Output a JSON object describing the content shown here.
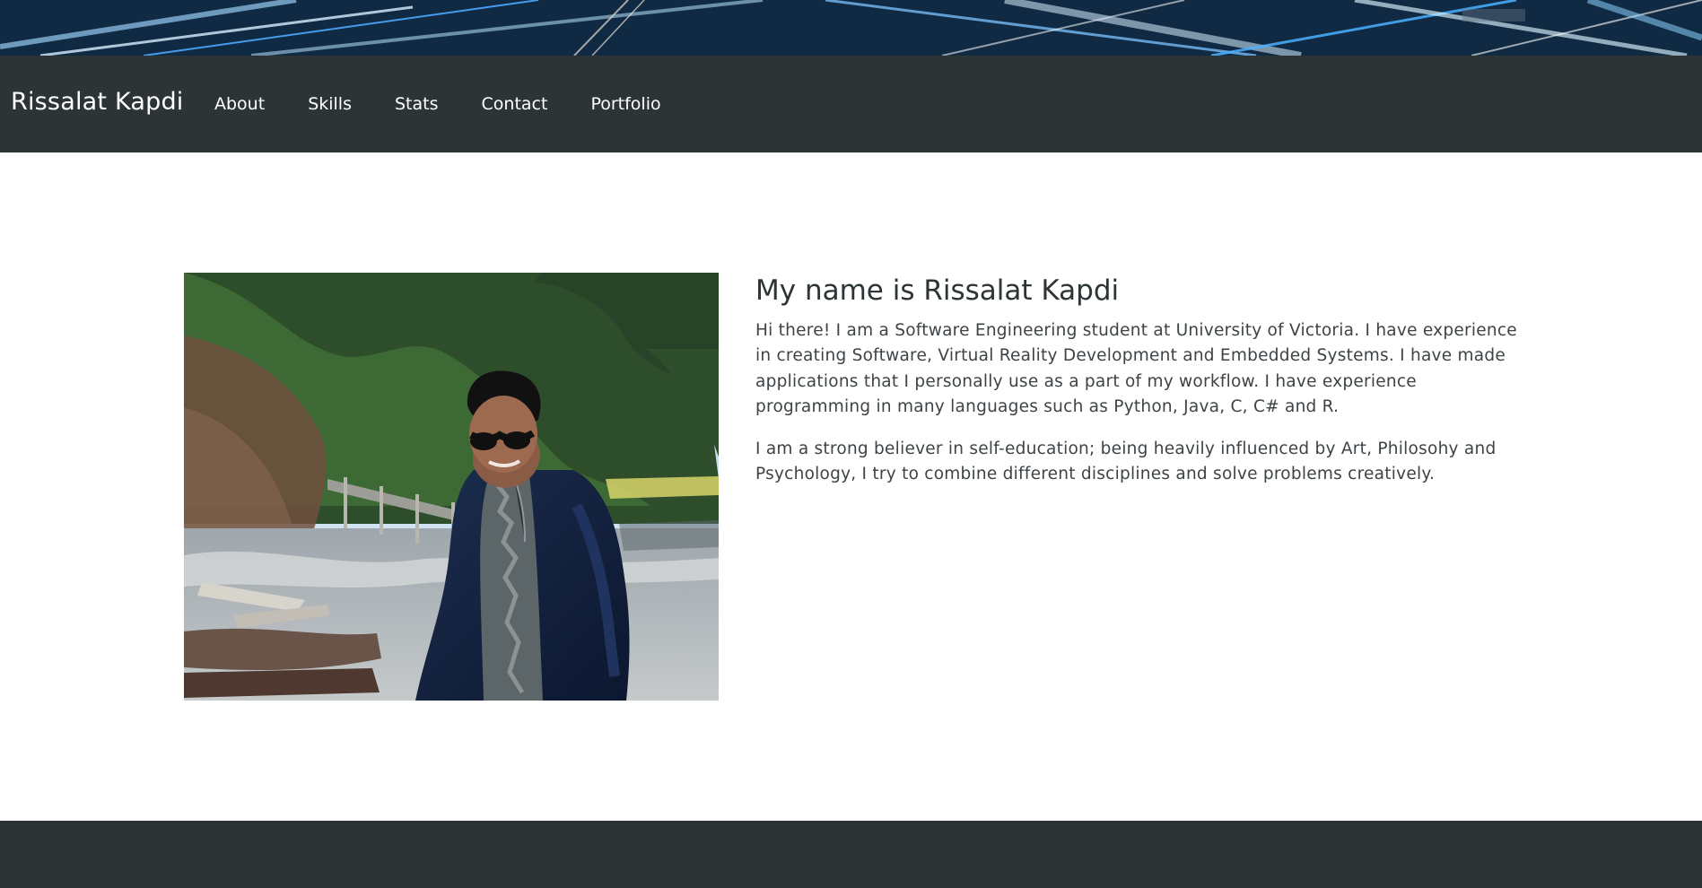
{
  "navbar": {
    "brand": "Rissalat Kapdi",
    "links": [
      {
        "label": "About"
      },
      {
        "label": "Skills"
      },
      {
        "label": "Stats"
      },
      {
        "label": "Contact"
      },
      {
        "label": "Portfolio"
      }
    ]
  },
  "about": {
    "heading": "My name is Rissalat Kapdi",
    "paragraphs": [
      "Hi there! I am a Software Engineering student at University of Victoria. I have experience in creating Software, Virtual Reality Development and Embedded Systems. I have made applications that I personally use as a part of my workflow. I have experience programming in many languages such as Python, Java, C, C# and R.",
      "I am a strong believer in self-education; being heavily influenced by Art, Philosohy and Psychology, I try to combine different disciplines and solve problems creatively."
    ]
  },
  "theme": {
    "navbar_background": "#2d3436",
    "text_color": "#343a40",
    "banner_accent": "#4fa3ff"
  }
}
